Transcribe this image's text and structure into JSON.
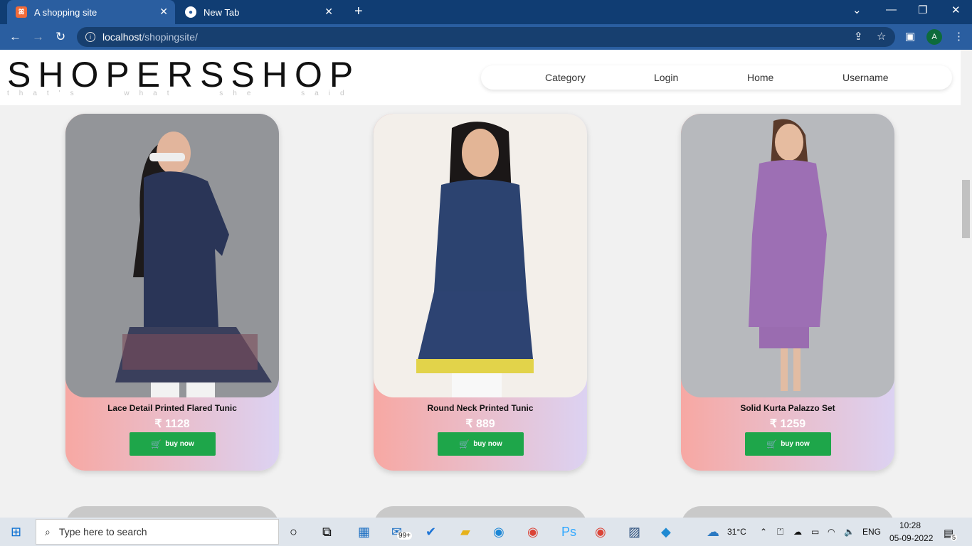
{
  "browser": {
    "tabs": [
      {
        "label": "A shopping site",
        "active": true
      },
      {
        "label": "New Tab",
        "active": false
      }
    ],
    "url_host": "localhost",
    "url_path": "/shopingsite/",
    "profile_initial": "A"
  },
  "site": {
    "logo": "SHOPERSSHOP",
    "tagline": "that's what she said",
    "nav": [
      "Category",
      "Login",
      "Home",
      "Username"
    ]
  },
  "products": [
    {
      "title": "Lace Detail Printed Flared Tunic",
      "price": "₹ 1128",
      "button": "buy now"
    },
    {
      "title": "Round Neck Printed Tunic",
      "price": "₹ 889",
      "button": "buy now"
    },
    {
      "title": "Solid Kurta Palazzo Set",
      "price": "₹ 1259",
      "button": "buy now"
    }
  ],
  "taskbar": {
    "search_placeholder": "Type here to search",
    "mail_badge": "99+",
    "temperature": "31°C",
    "language": "ENG",
    "time": "10:28",
    "date": "05-09-2022",
    "notifications": "5"
  },
  "colors": {
    "buy_button": "#1ea64a",
    "card_gradient_start": "#f7a8a3",
    "card_gradient_end": "#dcd2f2"
  }
}
